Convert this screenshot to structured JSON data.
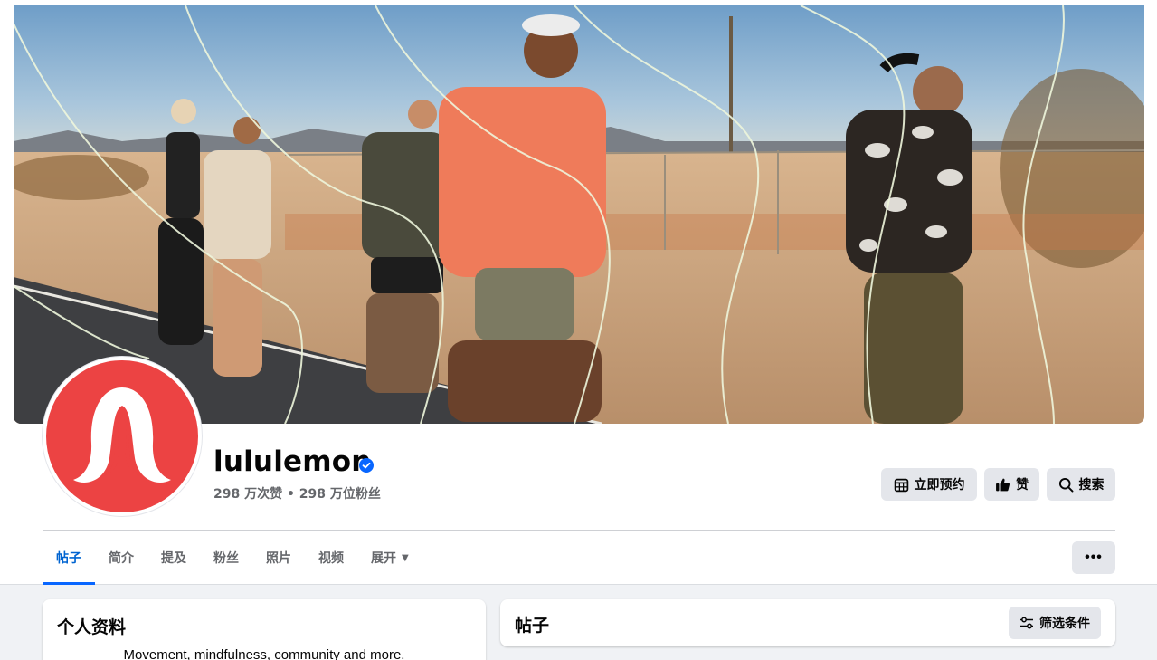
{
  "profile": {
    "name": "lululemon",
    "stats": "298 万次赞 • 298 万位粉丝"
  },
  "actions": {
    "book": "立即预约",
    "like": "赞",
    "search": "搜索"
  },
  "tabs": [
    {
      "label": "帖子",
      "active": true
    },
    {
      "label": "简介"
    },
    {
      "label": "提及"
    },
    {
      "label": "粉丝"
    },
    {
      "label": "照片"
    },
    {
      "label": "视频"
    },
    {
      "label": "展开"
    }
  ],
  "more_label": "•••",
  "intro": {
    "title": "个人资料",
    "bio": "Movement, mindfulness, community and more."
  },
  "posts": {
    "title": "帖子",
    "filter": "筛选条件"
  },
  "colors": {
    "brand_red": "#ec4343",
    "accent_blue": "#0866ff"
  },
  "icons": [
    "calendar-icon",
    "thumbs-up-icon",
    "search-icon",
    "verified-badge-icon",
    "filter-icon",
    "caret-down-icon",
    "more-icon"
  ]
}
